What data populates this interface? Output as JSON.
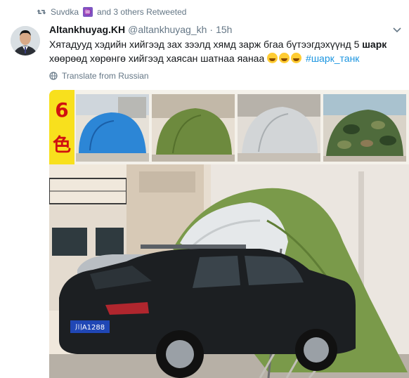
{
  "retweet": {
    "user": "Suvdka",
    "suffix": "and 3 others Retweeted",
    "icon": "retweet-icon",
    "badge_symbol": "♒"
  },
  "tweet": {
    "display_name": "Altankhuyag.KH",
    "handle": "@altankhuyag_kh",
    "separator": "·",
    "time": "15h",
    "text_part1": "Хятадууд хэдийн хийгээд зах зээлд хямд зарж бгаа бүтээгдэхүүнд 5",
    "text_bold": "шарк",
    "text_part2": "хөөрөөд хөрөнгө хийгээд хаясан шатнаа яанаа",
    "hashtag": "#шарк_танк",
    "translate_label": "Translate from Russian",
    "translate_icon": "globe-icon",
    "menu_icon": "chevron-down-icon"
  },
  "media": {
    "badge_number": "6",
    "badge_char": "色",
    "thumbnail_colors": [
      "#2c86d6",
      "#6d8a3e",
      "#cfd2d4",
      "#4f6b3c"
    ],
    "tent_color": "#7a9a4a",
    "car_color": "#1c1f22",
    "license_plate": "川A1288"
  },
  "colors": {
    "accent": "#1b95e0",
    "secondary_text": "#657786",
    "badge_bg": "#f8e01d",
    "badge_text": "#d01010"
  }
}
